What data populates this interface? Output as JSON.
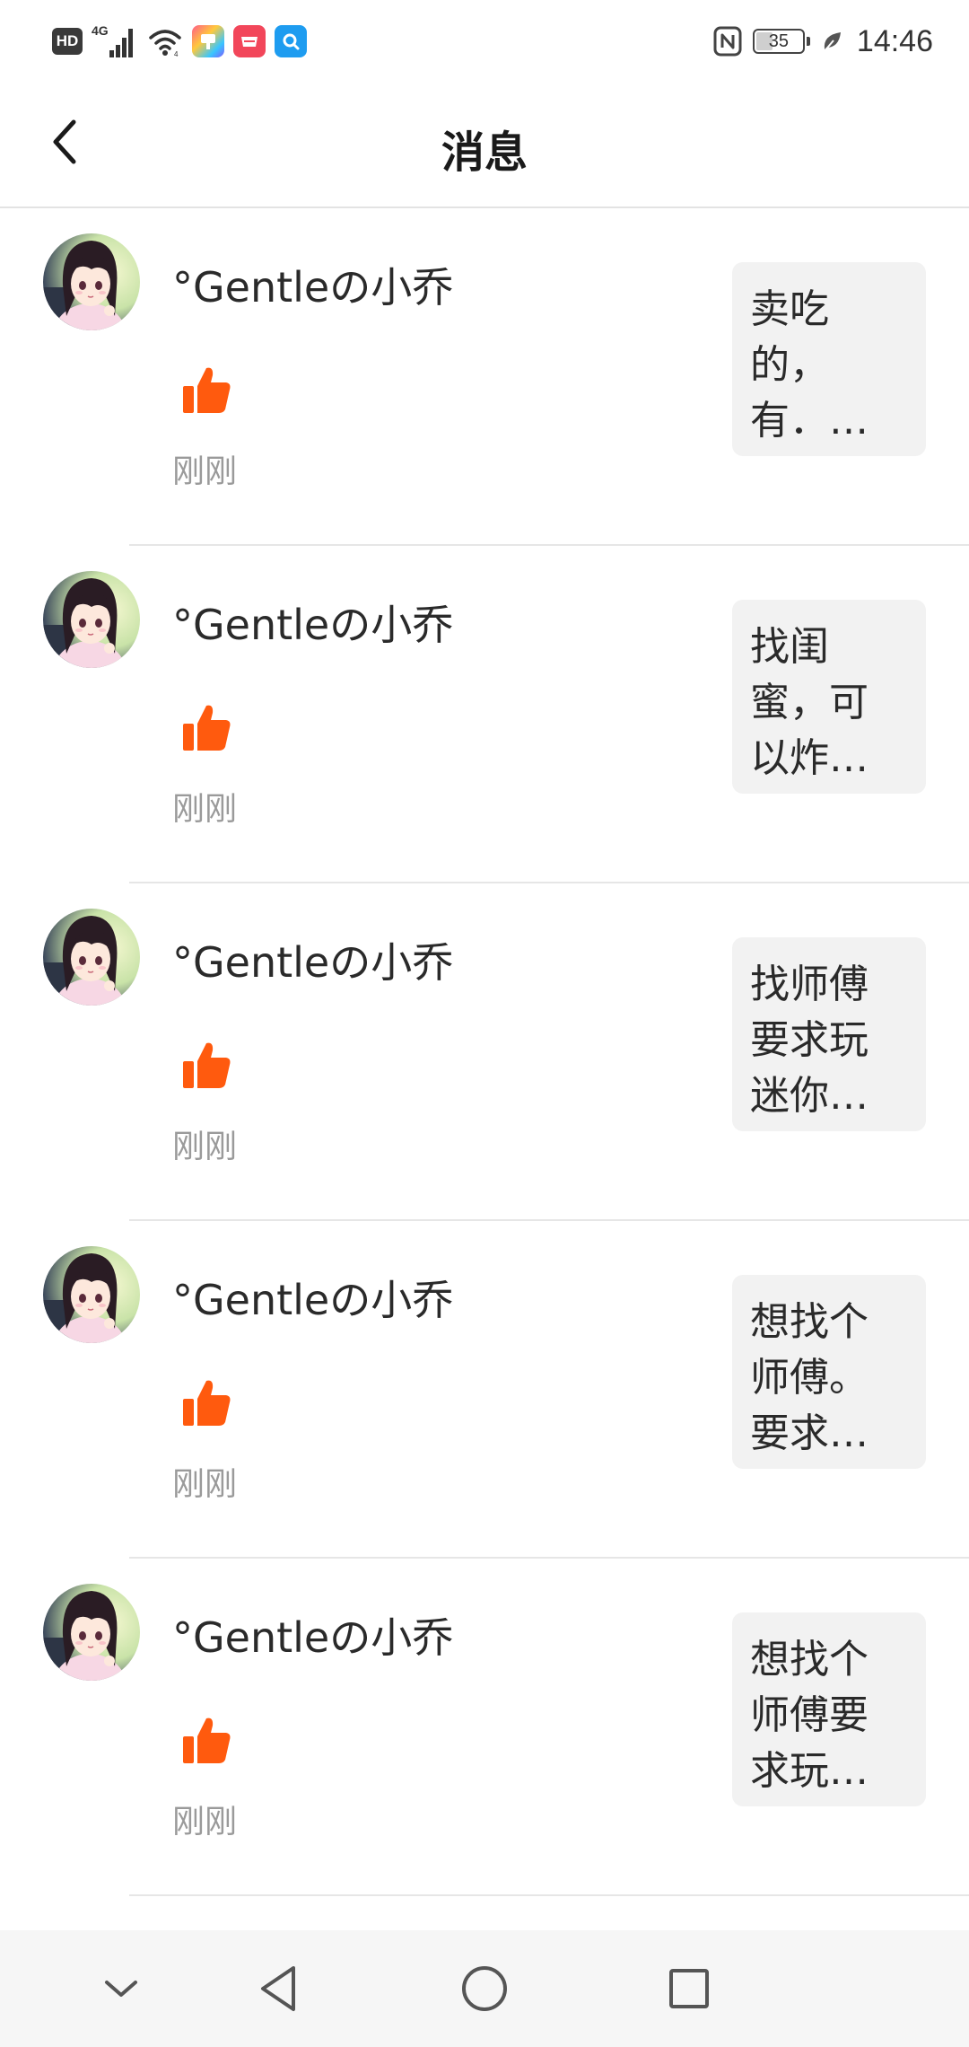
{
  "status_bar": {
    "hd_label": "HD",
    "network_type": "4G",
    "battery_level": "35",
    "battery_fraction": 0.35,
    "time": "14:46",
    "left_icons": [
      "hd-icon",
      "signal-icon",
      "wifi-icon",
      "multicolor-app-icon",
      "huawei-mall-icon",
      "search-app-icon"
    ],
    "right_icons": [
      "nfc-icon",
      "battery-icon",
      "leaf-icon"
    ]
  },
  "header": {
    "title": "消息",
    "back_icon": "chevron-left-icon"
  },
  "messages": [
    {
      "name": "°Gentleの小乔",
      "time": "刚刚",
      "preview": [
        "卖吃",
        "的，",
        "有．…"
      ]
    },
    {
      "name": "°Gentleの小乔",
      "time": "刚刚",
      "preview": [
        "找闺",
        "蜜，可",
        "以炸…"
      ]
    },
    {
      "name": "°Gentleの小乔",
      "time": "刚刚",
      "preview": [
        "找师傅",
        "要求玩",
        "迷你…"
      ]
    },
    {
      "name": "°Gentleの小乔",
      "time": "刚刚",
      "preview": [
        "想找个",
        "师傅。",
        "要求…"
      ]
    },
    {
      "name": "°Gentleの小乔",
      "time": "刚刚",
      "preview": [
        "想找个",
        "师傅要",
        "求玩…"
      ]
    }
  ],
  "colors": {
    "like": "#ff5a0e",
    "time_gray": "#9a9a9a",
    "preview_bg": "#f2f2f2",
    "divider": "#e6e6e6"
  },
  "nav_bar": {
    "icons": [
      "chevron-down-icon",
      "back-triangle-icon",
      "home-circle-icon",
      "recents-square-icon"
    ]
  }
}
